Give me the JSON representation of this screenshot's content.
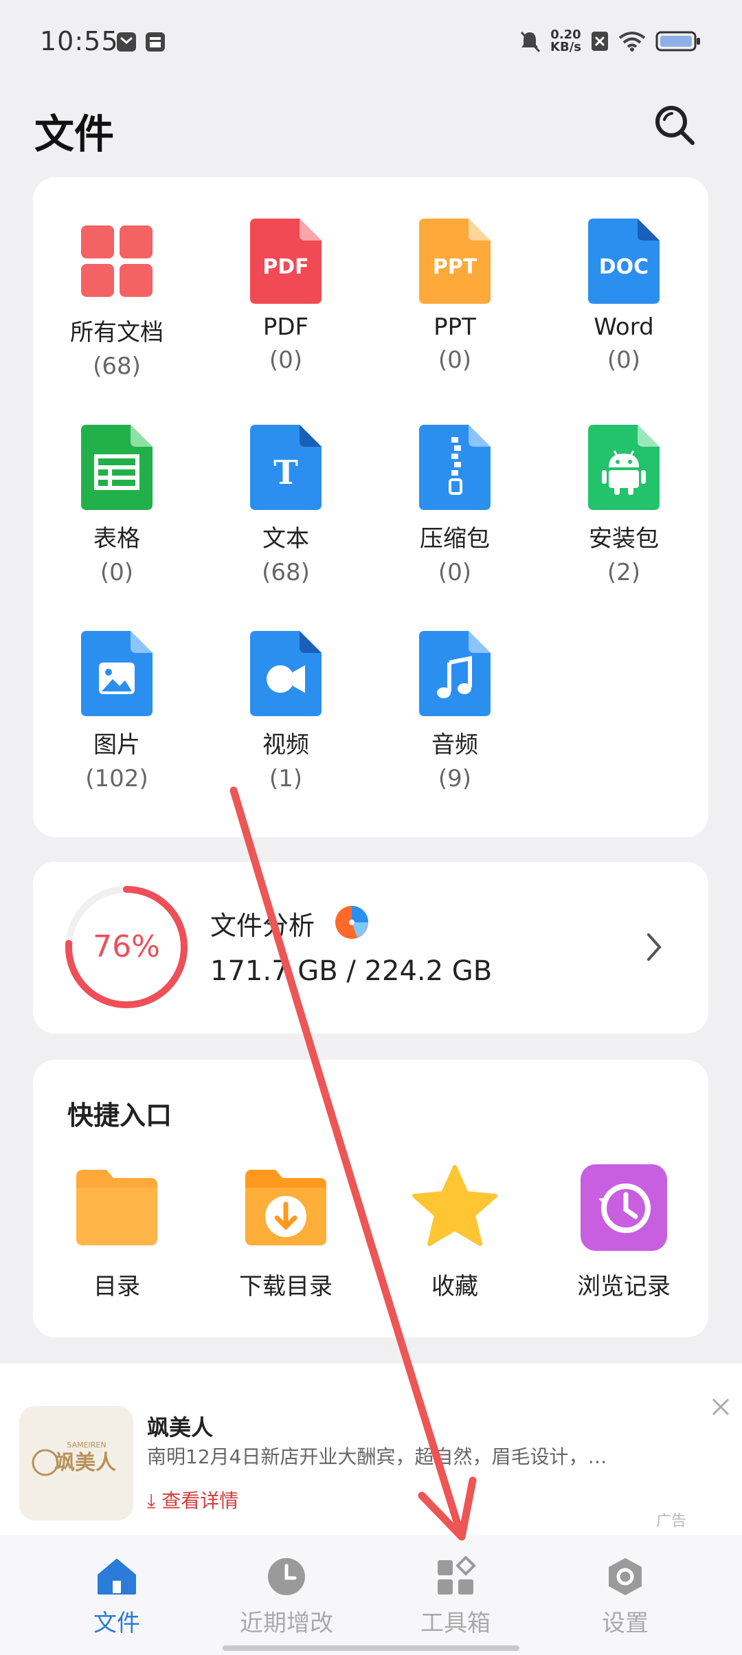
{
  "status_bar": {
    "time": "10:55",
    "net_speed_value": "0.20",
    "net_speed_unit": "KB/s"
  },
  "header": {
    "title": "文件"
  },
  "categories": [
    {
      "label": "所有文档",
      "count": "(68)"
    },
    {
      "label": "PDF",
      "count": "(0)"
    },
    {
      "label": "PPT",
      "count": "(0)"
    },
    {
      "label": "Word",
      "count": "(0)"
    },
    {
      "label": "表格",
      "count": "(0)"
    },
    {
      "label": "文本",
      "count": "(68)"
    },
    {
      "label": "压缩包",
      "count": "(0)"
    },
    {
      "label": "安装包",
      "count": "(2)"
    },
    {
      "label": "图片",
      "count": "(102)"
    },
    {
      "label": "视频",
      "count": "(1)"
    },
    {
      "label": "音频",
      "count": "(9)"
    }
  ],
  "icon_text": {
    "pdf": "PDF",
    "ppt": "PPT",
    "doc": "DOC",
    "txt": "T"
  },
  "storage": {
    "percent_label": "76%",
    "percent": 76,
    "title": "文件分析",
    "usage": "171.7 GB / 224.2 GB"
  },
  "quick_access": {
    "title": "快捷入口",
    "items": [
      {
        "label": "目录"
      },
      {
        "label": "下载目录"
      },
      {
        "label": "收藏"
      },
      {
        "label": "浏览记录"
      }
    ]
  },
  "ad": {
    "name": "飒美人",
    "description": "南明12月4日新店开业大酬宾，超自然，眉毛设计，…",
    "link": "查看详情",
    "tag": "广告",
    "logo_text": "飒美人",
    "logo_small": "SAMEIREN"
  },
  "bottom_nav": [
    {
      "label": "文件"
    },
    {
      "label": "近期增改"
    },
    {
      "label": "工具箱"
    },
    {
      "label": "设置"
    }
  ],
  "colors": {
    "accent": "#2b7bd9",
    "red_annotation": "#ee5555",
    "pdf": "#f24a55",
    "ppt": "#ffa93a",
    "doc": "#2b8ff0",
    "sheet": "#22b04a",
    "apk": "#22c36a"
  },
  "icons": {
    "search": "search-icon",
    "storage_ring": "storage-ring",
    "chevron": "chevron-right-icon",
    "pie": "pie-chart-icon",
    "close": "close-icon",
    "download": "download-icon"
  }
}
